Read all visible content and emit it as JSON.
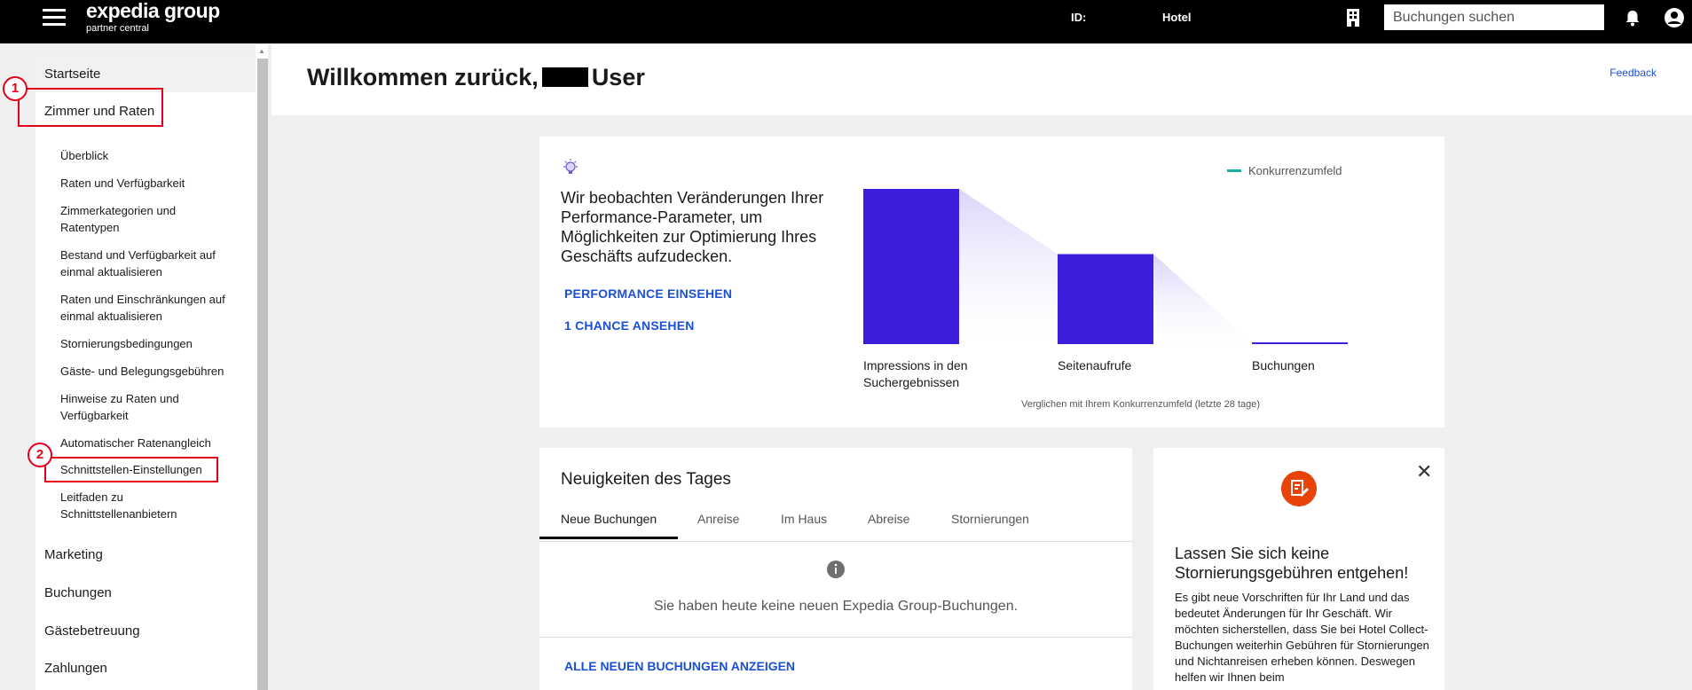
{
  "topbar": {
    "logo_main": "expedia group",
    "logo_sub": "partner central",
    "id_label": "ID:",
    "hotel_label": "Hotel",
    "search_placeholder": "Buchungen suchen"
  },
  "sidebar": {
    "items": [
      {
        "label": "Startseite"
      },
      {
        "label": "Zimmer und Raten"
      },
      {
        "label": "Marketing"
      },
      {
        "label": "Buchungen"
      },
      {
        "label": "Gästebetreuung"
      },
      {
        "label": "Zahlungen"
      }
    ],
    "subitems": [
      {
        "label": "Überblick"
      },
      {
        "label": "Raten und Verfügbarkeit"
      },
      {
        "label": "Zimmerkategorien und Ratentypen"
      },
      {
        "label": "Bestand und Verfügbarkeit auf einmal aktualisieren"
      },
      {
        "label": "Raten und Einschränkungen auf einmal aktualisieren"
      },
      {
        "label": "Stornierungsbedingungen"
      },
      {
        "label": "Gäste- und Belegungsgebühren"
      },
      {
        "label": "Hinweise zu Raten und Verfügbarkeit"
      },
      {
        "label": "Automatischer Ratenangleich"
      },
      {
        "label": "Schnittstellen-Einstellungen"
      },
      {
        "label": "Leitfaden zu Schnittstellenanbietern"
      }
    ],
    "badges": [
      "1",
      "2"
    ]
  },
  "welcome": {
    "title_prefix": "Willkommen zurück,",
    "title_suffix": "User",
    "feedback": "Feedback"
  },
  "performance": {
    "text": "Wir beobachten Veränderungen Ihrer Performance-Parameter, um Möglichkeiten zur Optimierung Ihres Geschäfts aufzudecken.",
    "link_performance": "PERFORMANCE EINSEHEN",
    "link_chance": "1 CHANCE ANSEHEN",
    "legend": "Konkurrenzumfeld",
    "compare_note": "Verglichen mit Ihrem Konkurrenzumfeld (letzte 28 tage)",
    "bar_color": "#3b1fdc",
    "legend_color": "#1ab0a0"
  },
  "chart_data": {
    "type": "bar",
    "categories": [
      "Impressions in den Suchergebnissen",
      "Seitenaufrufe",
      "Buchungen"
    ],
    "values": [
      100,
      58,
      1
    ],
    "title": "",
    "xlabel": "",
    "ylabel": "",
    "ylim": [
      0,
      100
    ]
  },
  "news": {
    "title": "Neuigkeiten des Tages",
    "tabs": [
      {
        "label": "Neue Buchungen"
      },
      {
        "label": "Anreise"
      },
      {
        "label": "Im Haus"
      },
      {
        "label": "Abreise"
      },
      {
        "label": "Stornierungen"
      }
    ],
    "empty_text": "Sie haben heute keine neuen Expedia Group-Buchungen.",
    "all_link": "ALLE NEUEN BUCHUNGEN ANZEIGEN"
  },
  "promo": {
    "title": "Lassen Sie sich keine Stornierungsgebühren entgehen!",
    "body": "Es gibt neue Vorschriften für Ihr Land und das bedeutet Änderungen für Ihr Geschäft. Wir möchten sicherstellen, dass Sie bei Hotel Collect-Buchungen weiterhin Gebühren für Stornierungen und Nichtanreisen erheben können. Deswegen helfen wir Ihnen beim",
    "accent": "#e8440a"
  }
}
